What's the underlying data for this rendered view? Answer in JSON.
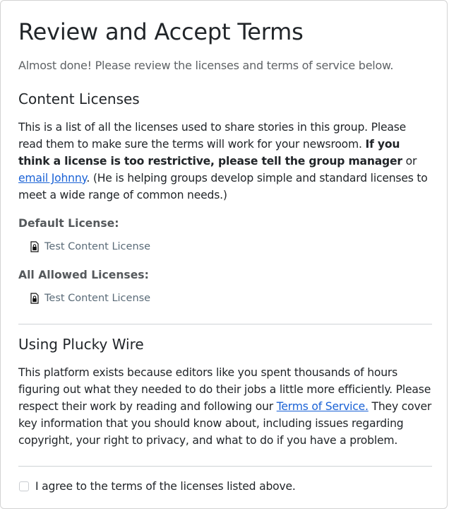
{
  "page": {
    "title": "Review and Accept Terms",
    "lead": "Almost done! Please review the licenses and terms of service below."
  },
  "content_licenses": {
    "heading": "Content Licenses",
    "text_1": "This is a list of all the licenses used to share stories in this group. Please read them to make sure the terms will work for your newsroom. ",
    "text_bold": "If you think a license is too restrictive, please tell the group manager",
    "text_2": " or ",
    "email_link": "email Johnny",
    "text_3": ". (He is helping groups develop simple and standard licenses to meet a wide range of common needs.)",
    "default_label": "Default License:",
    "default_license": "Test Content License",
    "allowed_label": "All Allowed Licenses:",
    "allowed_licenses": [
      "Test Content License"
    ]
  },
  "using_wire": {
    "heading": "Using Plucky Wire",
    "text_1": "This platform exists because editors like you spent thousands of hours figuring out what they needed to do their jobs a little more efficiently. Please respect their work by reading and following our ",
    "tos_link": "Terms of Service.",
    "text_2": " They cover key information that you should know about, including issues regarding copyright, your right to privacy, and what to do if you have a problem."
  },
  "agreement": {
    "checkbox_label": "I agree to the terms of the licenses listed above.",
    "checked": false
  },
  "icons": {
    "license": "lock-document-icon"
  },
  "colors": {
    "link": "#1a62d6",
    "muted_text": "#5f6366",
    "license_text": "#5a6b78"
  }
}
